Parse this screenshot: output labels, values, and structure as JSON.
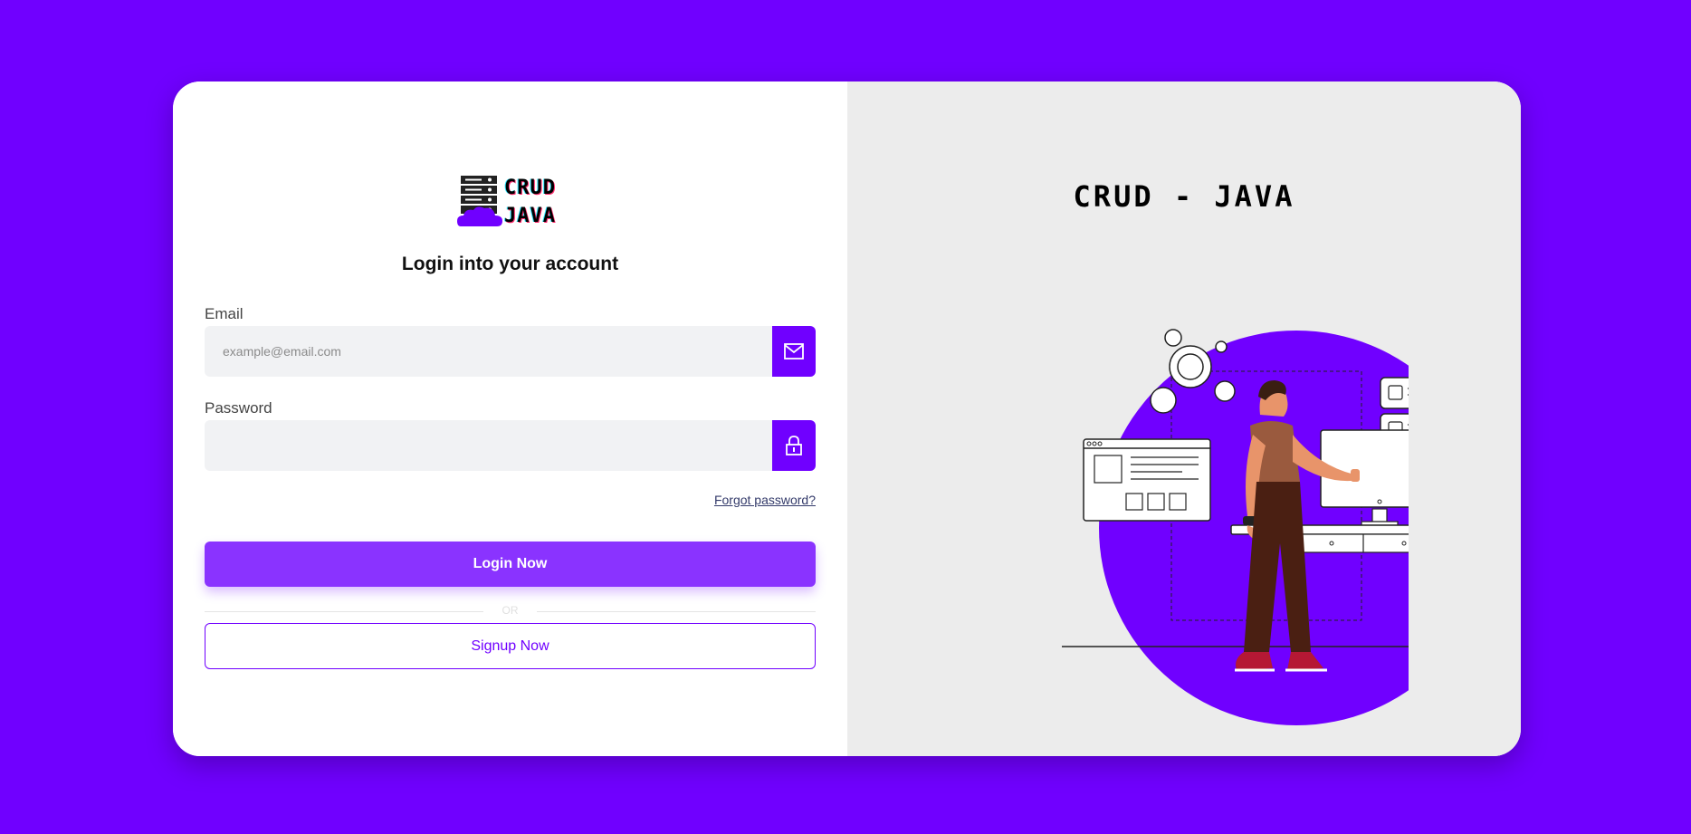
{
  "logo": {
    "line1": "CRUD",
    "line2": "JAVA"
  },
  "login": {
    "heading": "Login into your account",
    "email_label": "Email",
    "email_placeholder": "example@email.com",
    "email_value": "",
    "password_label": "Password",
    "password_value": "",
    "forgot_password": "Forgot password?",
    "login_button": "Login Now",
    "divider_text": "OR",
    "signup_button": "Signup Now"
  },
  "hero": {
    "title": "CRUD - JAVA"
  },
  "icons": {
    "email": "mail-icon",
    "password": "lock-icon",
    "logo": "server-cloud-icon"
  },
  "colors": {
    "brand": "#7000ff",
    "login_button": "#8a33ff",
    "panel_bg": "#ececec"
  }
}
